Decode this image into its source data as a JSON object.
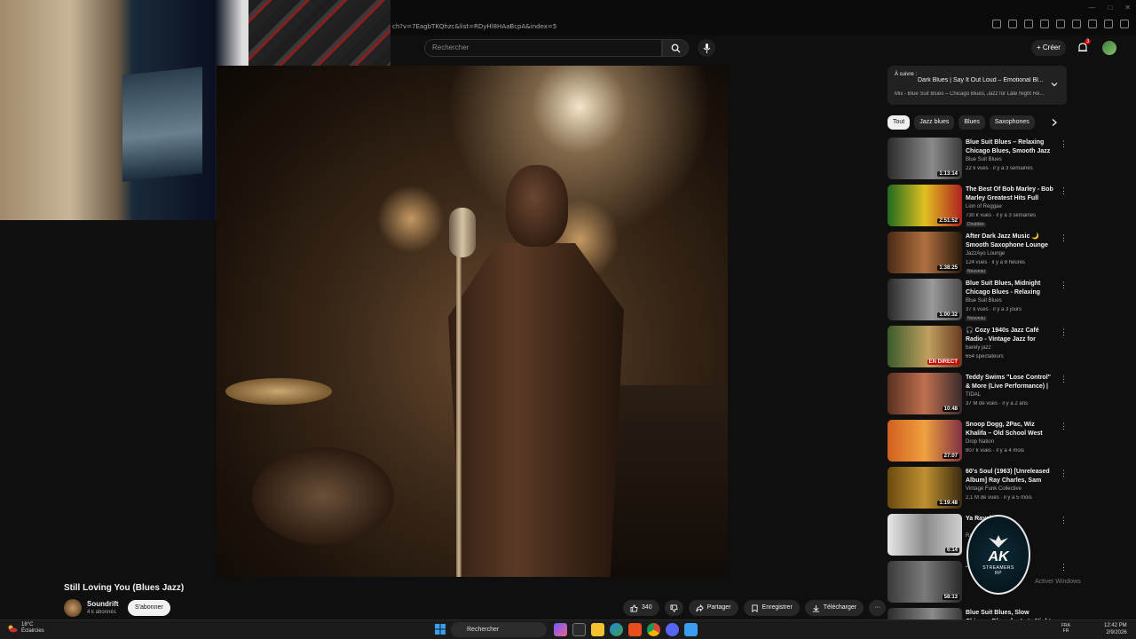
{
  "browser": {
    "url": "ch?v=7EagbTKQhzc&list=RDyHl8HAaBcpA&index=5"
  },
  "header": {
    "search_placeholder": "Rechercher",
    "create_label": "Créer",
    "notif_count": "3"
  },
  "video": {
    "title": "Still Loving You (Blues Jazz)",
    "channel": "Soundrift",
    "subscribers": "4 k abonnés",
    "subscribe_label": "S'abonner",
    "likes": "340",
    "share_label": "Partager",
    "save_label": "Enregistrer",
    "download_label": "Télécharger"
  },
  "playlist": {
    "up_next_label": "À suivre :",
    "next_title": "Dark Blues | Say It Out Loud – Emotional Bl...",
    "meta": "Mix - Blue Suit Blues – Chicago Blues, Jazz for Late Night Re..."
  },
  "chips": [
    "Tout",
    "Jazz blues",
    "Blues",
    "Saxophones"
  ],
  "recommendations": [
    {
      "title": "Blue Suit Blues – Relaxing Chicago Blues, Smooth Jazz f...",
      "channel": "Blue Suit Blues",
      "meta": "22 k vues · il y a 3 semaines",
      "duration": "1:13:14",
      "badge": "",
      "thumb_bg": "linear-gradient(90deg,#2b2b2b,#8a8a8a 60%,#3a3a3a)"
    },
    {
      "title": "The Best Of Bob Marley - Bob Marley Greatest Hits Full Albu...",
      "channel": "Lion of Reggae",
      "meta": "730 k vues · il y a 3 semaines",
      "duration": "2:51:52",
      "badge": "Doublée",
      "thumb_bg": "linear-gradient(90deg,#1f6a1f,#e0c020 50%,#b02020)"
    },
    {
      "title": "After Dark Jazz Music 🌙 Smooth Saxophone Lounge fo...",
      "channel": "JazzAyo Lounge",
      "meta": "124 vues · il y a 8 heures",
      "duration": "1:38:25",
      "badge": "Nouveau",
      "thumb_bg": "linear-gradient(90deg,#4a2a14,#b07040 50%,#2a1a0c)"
    },
    {
      "title": "Blue Suit Blues, Midnight Chicago Blues - Relaxing Jazz ...",
      "channel": "Blue Suit Blues",
      "meta": "37 k vues · il y a 3 jours",
      "duration": "1:00:32",
      "badge": "Nouveau",
      "thumb_bg": "linear-gradient(90deg,#2a2a2a,#9a9a9a 60%,#4a4a4a)"
    },
    {
      "title": "🎧 Cozy 1940s Jazz Café Radio - Vintage Jazz for Relaxing & ...",
      "channel": "barely jazz",
      "meta": "654 spectateurs",
      "duration": "EN DIRECT",
      "badge": "",
      "thumb_bg": "linear-gradient(90deg,#3a5a2a,#c0a060 55%,#6a3a20)"
    },
    {
      "title": "Teddy Swims \"Lose Control\" & More (Live Performance) | ...",
      "channel": "TIDAL",
      "meta": "37 M de vues · il y a 2 ans",
      "duration": "10:48",
      "badge": "",
      "thumb_bg": "linear-gradient(90deg,#5a3020,#c07050 50%,#3a2a2a)"
    },
    {
      "title": "Snoop Dogg, 2Pac, Wiz Khalifa – Old School West Coast Rap ...",
      "channel": "Drop Nation",
      "meta": "807 k vues · il y a 4 mois",
      "duration": "27:07",
      "badge": "",
      "thumb_bg": "linear-gradient(90deg,#d06020,#f0a040 50%,#803040)"
    },
    {
      "title": "60's Soul (1963) [Unreleased Album] Ray Charles, Sam Coo...",
      "channel": "Vintage Funk Collective",
      "meta": "2,1 M de vues · il y a 5 mois",
      "duration": "1:19:48",
      "badge": "",
      "thumb_bg": "linear-gradient(90deg,#6a4a10,#c09030 50%,#3a2a10)"
    },
    {
      "title": "Ya Rayah",
      "channel": "Ra...",
      "meta": "",
      "duration": "6:14",
      "badge": "",
      "thumb_bg": "linear-gradient(90deg,#e8e8e8,#8a8a8a 50%,#d0d0d0)"
    },
    {
      "title": "...ey Silent |",
      "channel": "",
      "meta": "",
      "duration": "58:13",
      "badge": "",
      "thumb_bg": "linear-gradient(90deg,#3a3a3a,#7a7a7a 50%,#2a2a2a)"
    },
    {
      "title": "Blue Suit Blues, Slow Chicago Blues for Late Night Relaxation",
      "channel": "",
      "meta": "",
      "duration": "",
      "badge": "",
      "thumb_bg": "linear-gradient(90deg,#2b2b2b,#8a8a8a 60%,#3a3a3a)"
    }
  ],
  "overlay": {
    "logo_main": "AK",
    "logo_sub": "STREAMERS",
    "logo_tag": "RP",
    "windows_activate": "Activer Windows"
  },
  "taskbar": {
    "temp": "18°C",
    "weather": "Éclaircies",
    "search_label": "Rechercher",
    "lang_top": "FRA",
    "lang_bottom": "FR",
    "time": "12:42 PM",
    "date": "2/9/2026"
  }
}
